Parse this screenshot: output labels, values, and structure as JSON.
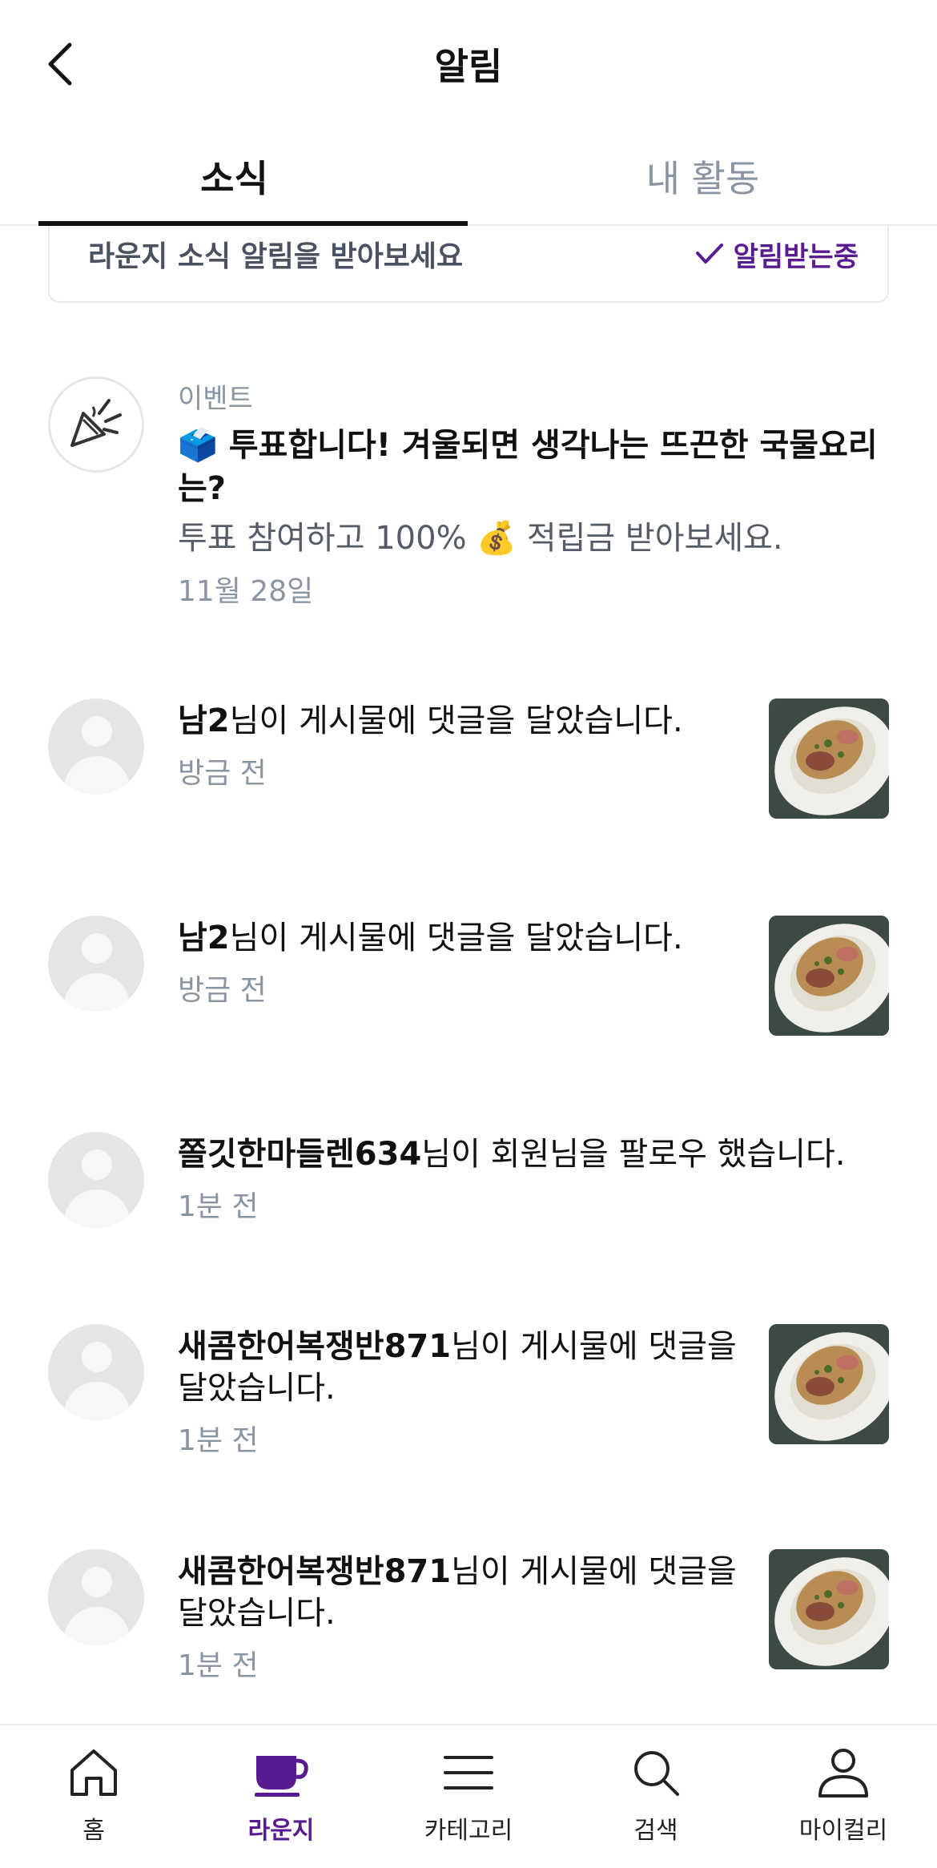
{
  "header": {
    "title": "알림"
  },
  "tabs": [
    {
      "label": "소식",
      "active": true
    },
    {
      "label": "내 활동",
      "active": false
    }
  ],
  "subscription": {
    "text": "라운지 소식 알림을 받아보세요",
    "status": "알림받는중"
  },
  "event": {
    "category": "이벤트",
    "title": "🗳️ 투표합니다! 겨울되면 생각나는 뜨끈한 국물요리는?",
    "desc": "투표 참여하고 100% 💰 적립금 받아보세요.",
    "time": "11월 28일"
  },
  "notifications": [
    {
      "name": "남2",
      "message": "님이 게시물에 댓글을 달았습니다.",
      "time": "방금 전",
      "has_thumb": true
    },
    {
      "name": "남2",
      "message": "님이 게시물에 댓글을 달았습니다.",
      "time": "방금 전",
      "has_thumb": true
    },
    {
      "name": "쫄깃한마들렌634",
      "message": "님이 회원님을 팔로우 했습니다.",
      "time": "1분 전",
      "has_thumb": false
    },
    {
      "name": "새콤한어복쟁반871",
      "message": "님이 게시물에 댓글을 달았습니다.",
      "time": "1분 전",
      "has_thumb": true
    },
    {
      "name": "새콤한어복쟁반871",
      "message": "님이 게시물에 댓글을 달았습니다.",
      "time": "1분 전",
      "has_thumb": true
    }
  ],
  "bottom_nav": [
    {
      "label": "홈",
      "icon": "home-icon",
      "active": false
    },
    {
      "label": "라운지",
      "icon": "cup-icon",
      "active": true
    },
    {
      "label": "카테고리",
      "icon": "menu-icon",
      "active": false
    },
    {
      "label": "검색",
      "icon": "search-icon",
      "active": false
    },
    {
      "label": "마이컬리",
      "icon": "person-icon",
      "active": false
    }
  ],
  "colors": {
    "accent": "#5a1a91",
    "muted": "#8a95a3"
  }
}
